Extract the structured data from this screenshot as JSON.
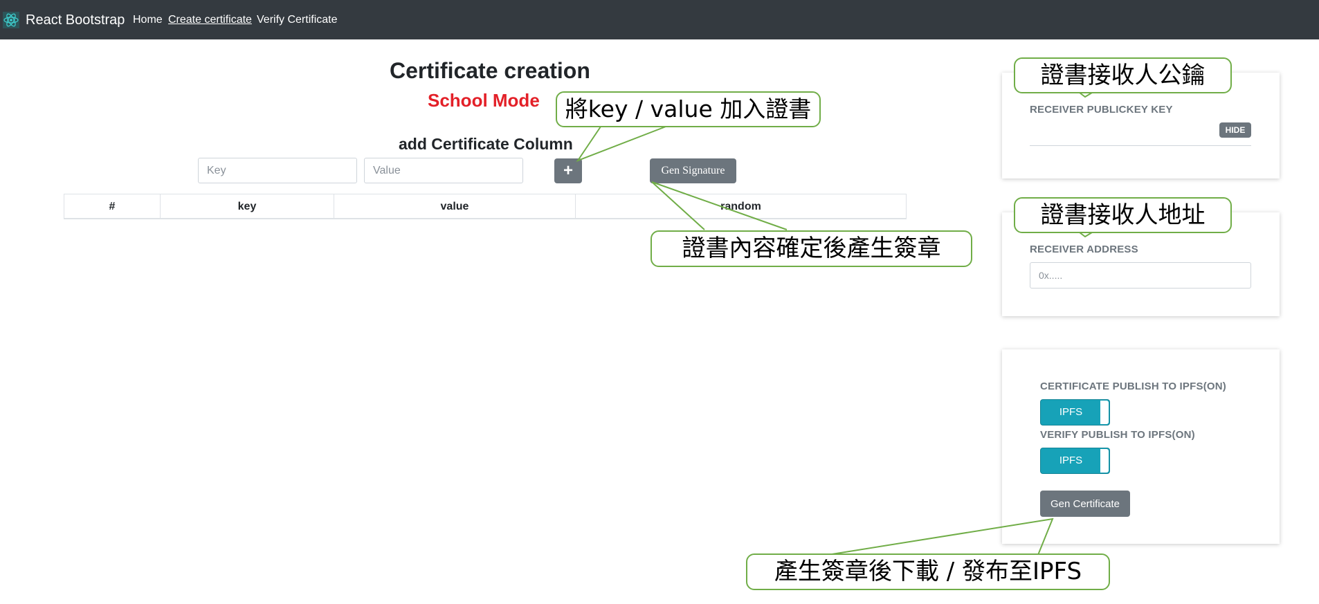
{
  "navbar": {
    "brand": "React Bootstrap",
    "links": [
      "Home",
      "Create certificate",
      "Verify Certificate"
    ],
    "active_link": "Create certificate"
  },
  "main": {
    "title": "Certificate creation",
    "mode": "School Mode",
    "section_title": "add Certificate Column",
    "key_placeholder": "Key",
    "value_placeholder": "Value",
    "add_button": "+",
    "gen_signature_button": "Gen Signature",
    "table_headers": [
      "#",
      "key",
      "value",
      "random"
    ]
  },
  "right_panel": {
    "publickey_label": "RECEIVER PUBLICKEY KEY",
    "hide_badge": "HIDE",
    "address_label": "RECEIVER ADDRESS",
    "address_placeholder": "0x.....",
    "cert_publish_label": "CERTIFICATE PUBLISH TO IPFS(ON)",
    "cert_publish_toggle": "IPFS",
    "verify_publish_label": "VERIFY PUBLISH TO IPFS(ON)",
    "verify_publish_toggle": "IPFS",
    "gen_certificate_button": "Gen Certificate"
  },
  "callouts": {
    "add_to_certificate": "將key / value 加入證書",
    "receiver_publickey": "證書接收人公鑰",
    "receiver_address": "證書接收人地址",
    "gen_signature_hint": "證書內容確定後產生簽章",
    "download_publish": "產生簽章後下載 / 發布至IPFS"
  },
  "colors": {
    "navbar_bg": "#343a40",
    "mode_red": "#e32028",
    "button_gray": "#6c757d",
    "toggle_teal": "#17a2b8",
    "callout_border": "#70ad47"
  }
}
